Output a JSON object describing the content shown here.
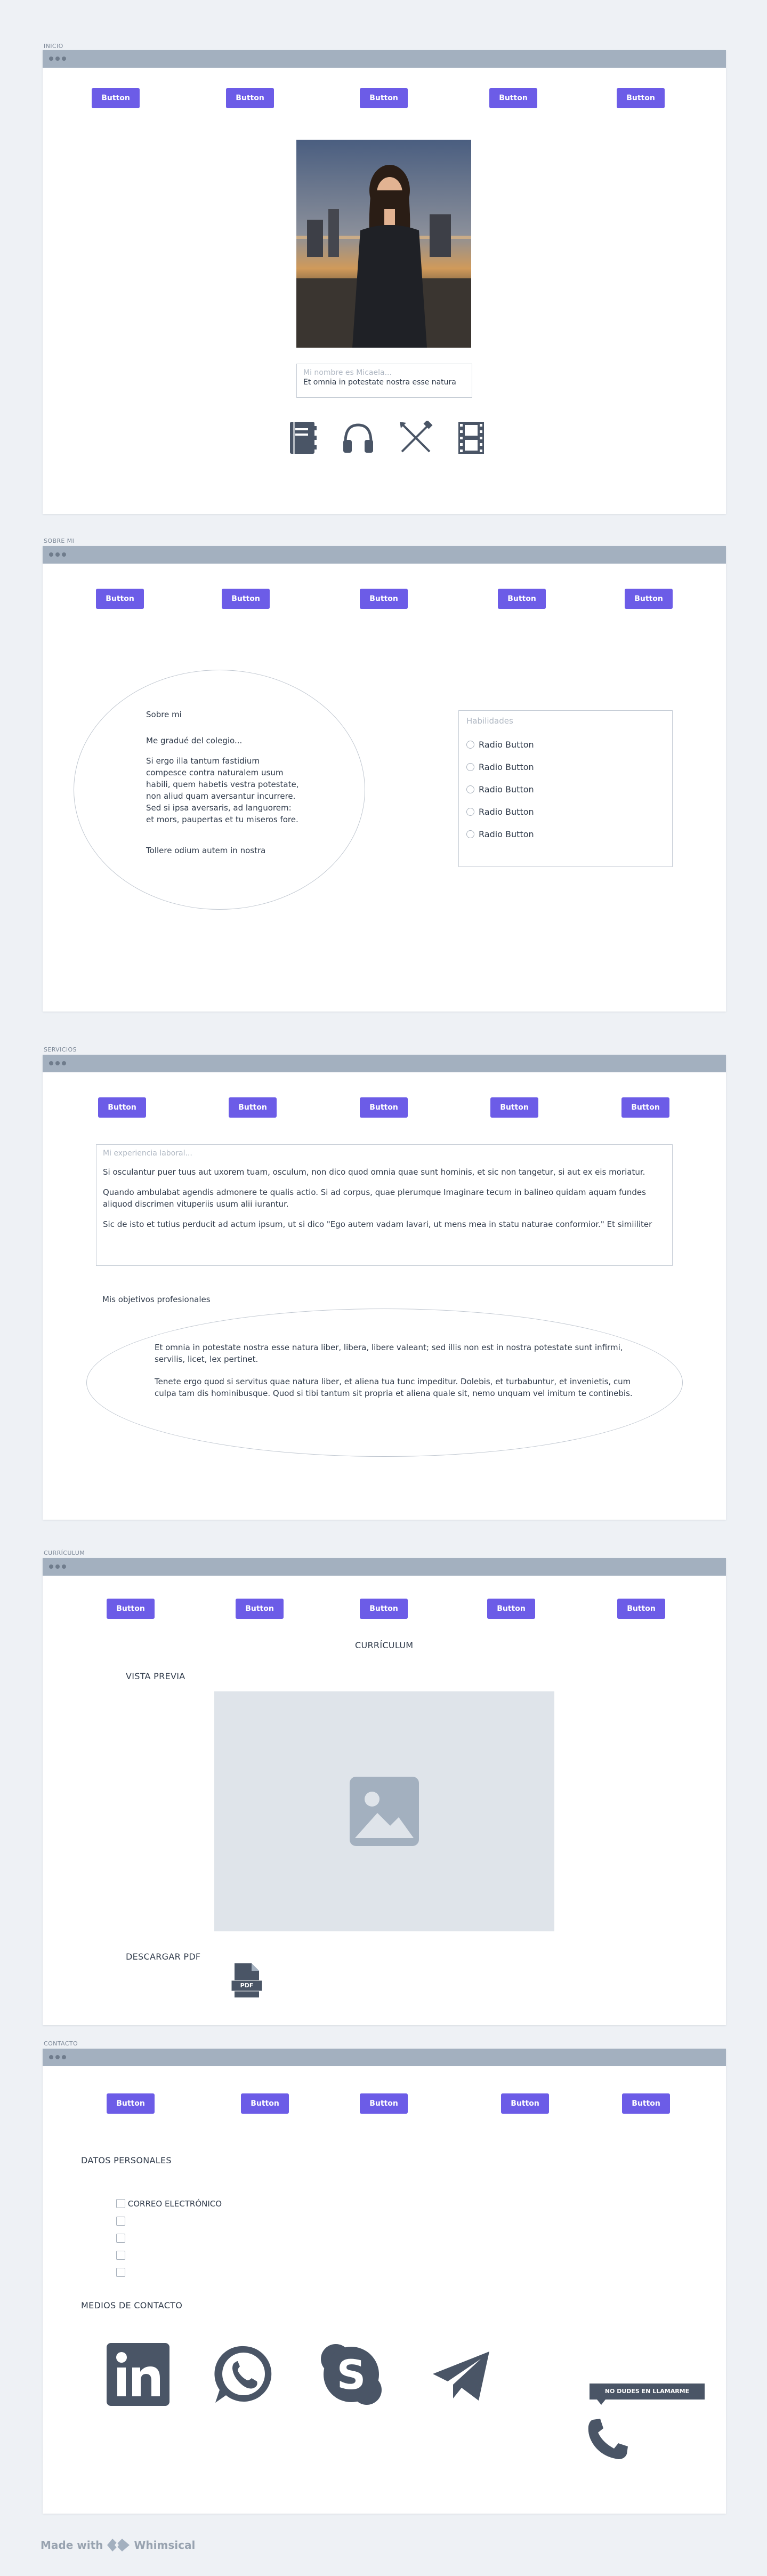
{
  "common": {
    "button_label": "Button"
  },
  "inicio": {
    "section_label": "INICIO",
    "intro_placeholder": "Mi nombre es Micaela...",
    "intro_text": "Et omnia in potestate nostra esse natura",
    "icons": [
      "notebook-icon",
      "headphones-icon",
      "crossed-tools-icon",
      "film-icon"
    ]
  },
  "sobre_mi": {
    "section_label": "SOBRE MI",
    "ellipse_lines": {
      "title": "Sobre mi",
      "line1": "Me gradué del colegio...",
      "para": [
        "Si ergo illa tantum fastidium",
        "compesce contra naturalem usum",
        "habili, quem habetis vestra potestate,",
        "non aliud quam aversantur incurrere.",
        "Sed si ipsa aversaris, ad languorem:",
        "et mors, paupertas et tu miseros fore."
      ],
      "closing": "Tollere odium autem in nostra"
    },
    "habilidades": {
      "title": "Habilidades",
      "radios": [
        "Radio Button",
        "Radio Button",
        "Radio Button",
        "Radio Button",
        "Radio Button"
      ]
    }
  },
  "servicios": {
    "section_label": "SERVICIOS",
    "experience_placeholder": "Mi experiencia laboral...",
    "experience_paras": [
      "Si osculantur puer tuus aut uxorem tuam, osculum, non dico quod omnia quae sunt hominis, et sic non tangetur, si aut ex eis moriatur.",
      "Quando ambulabat agendis admonere te qualis actio. Si ad corpus, quae plerumque Imaginare tecum in balineo quidam aquam fundes aliquod discrimen vituperiis usum alii iurantur.",
      "Sic de isto et tutius perducit ad actum ipsum, ut si dico \"Ego autem vadam lavari, ut mens mea in statu naturae conformior.\" Et simiiliter"
    ],
    "objectives_title": "Mis objetivos profesionales",
    "objectives_paras": [
      "Et omnia in potestate nostra esse natura liber, libera, libere valeant; sed illis non est in nostra potestate sunt infirmi, servilis, licet, lex pertinet.",
      "Tenete ergo quod si servitus quae natura liber, et aliena tua tunc impeditur. Dolebis, et turbabuntur, et invenietis, cum culpa tam dis hominibusque. Quod si tibi tantum sit propria et aliena quale sit, nemo unquam vel imitum te continebis."
    ]
  },
  "curriculum": {
    "section_label": "CURRÍCULUM",
    "title": "CURRÍCULUM",
    "preview_label": "VISTA PREVIA",
    "download_label": "DESCARGAR PDF",
    "pdf_badge": "PDF",
    "image_icon": "image-placeholder-icon"
  },
  "contacto": {
    "section_label": "CONTACTO",
    "personal_title": "DATOS PERSONALES",
    "checkbox_labels": [
      "CORREO ELECTRÓNICO",
      "",
      "",
      "",
      ""
    ],
    "contact_title": "MEDIOS DE CONTACTO",
    "tooltip": "NO DUDES EN LLAMARME",
    "icons": [
      "linkedin-icon",
      "whatsapp-icon",
      "skype-icon",
      "telegram-icon",
      "phone-icon"
    ]
  },
  "footer": {
    "made_with": "Made with",
    "brand": "Whimsical"
  },
  "colors": {
    "accent": "#6c5ce7",
    "titlebar": "#a3b0bf",
    "icon": "#4a5566",
    "background": "#eef1f5"
  }
}
